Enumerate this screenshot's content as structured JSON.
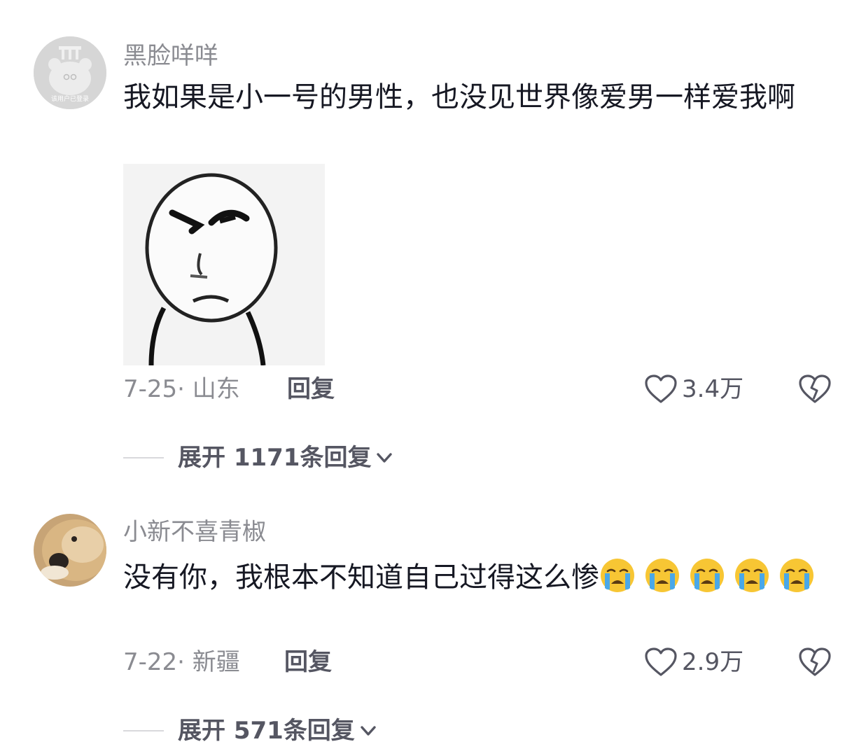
{
  "comments": [
    {
      "username": "黑脸咩咩",
      "avatar_text": "该用户已登录",
      "text": "我如果是小一号的男性，也没见世界像爱男一样爱我啊",
      "date_location": "7-25· 山东",
      "reply_label": "回复",
      "likes": "3.4万",
      "expand_label": "展开 1171条回复"
    },
    {
      "username": "小新不喜青椒",
      "text": "没有你，我根本不知道自己过得这么惨",
      "emojis": [
        "crying-emoji",
        "crying-emoji",
        "crying-emoji",
        "crying-emoji",
        "crying-emoji"
      ],
      "date_location": "7-22· 新疆",
      "reply_label": "回复",
      "likes": "2.9万",
      "expand_label": "展开 571条回复"
    }
  ],
  "colors": {
    "secondary_text": "#8a8b91",
    "primary_text": "#161823",
    "action_text": "#555662",
    "emoji_yellow": "#f7c634",
    "emoji_tear": "#4aa8e8"
  }
}
